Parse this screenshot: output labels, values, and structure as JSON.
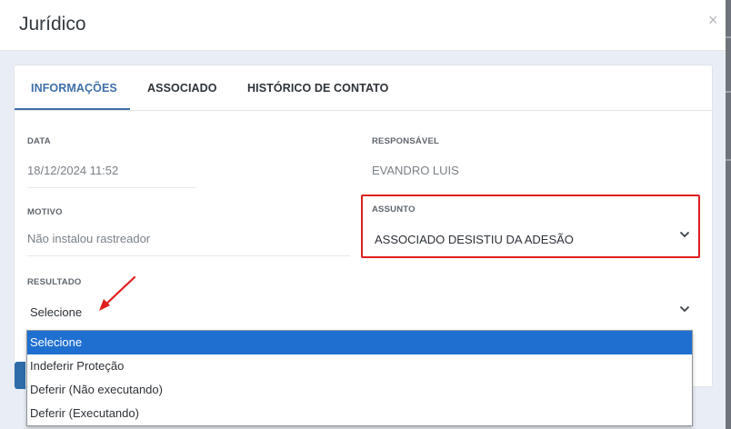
{
  "modal": {
    "title": "Jurídico",
    "close_label": "×"
  },
  "tabs": [
    {
      "label": "INFORMAÇÕES",
      "active": true
    },
    {
      "label": "ASSOCIADO",
      "active": false
    },
    {
      "label": "HISTÓRICO DE CONTATO",
      "active": false
    }
  ],
  "fields": {
    "data": {
      "label": "DATA",
      "value": "18/12/2024 11:52"
    },
    "responsavel": {
      "label": "RESPONSÁVEL",
      "value": "EVANDRO LUIS"
    },
    "motivo": {
      "label": "MOTIVO",
      "value": "Não instalou rastreador"
    },
    "assunto": {
      "label": "ASSUNTO",
      "value": "ASSOCIADO DESISTIU DA ADESÃO"
    },
    "resultado": {
      "label": "RESULTADO",
      "value": "Selecione"
    }
  },
  "resultado_options": [
    {
      "label": "Selecione",
      "selected": true
    },
    {
      "label": "Indeferir Proteção",
      "selected": false
    },
    {
      "label": "Deferir (Não executando)",
      "selected": false
    },
    {
      "label": "Deferir (Executando)",
      "selected": false
    }
  ],
  "colors": {
    "accent": "#3f6fa8",
    "highlight_box": "#e01e1e",
    "selected_option": "#1f6fd1"
  },
  "icons": {
    "close": "close-icon",
    "select": "chevron-down-icon",
    "annotation": "red-arrow-icon"
  }
}
